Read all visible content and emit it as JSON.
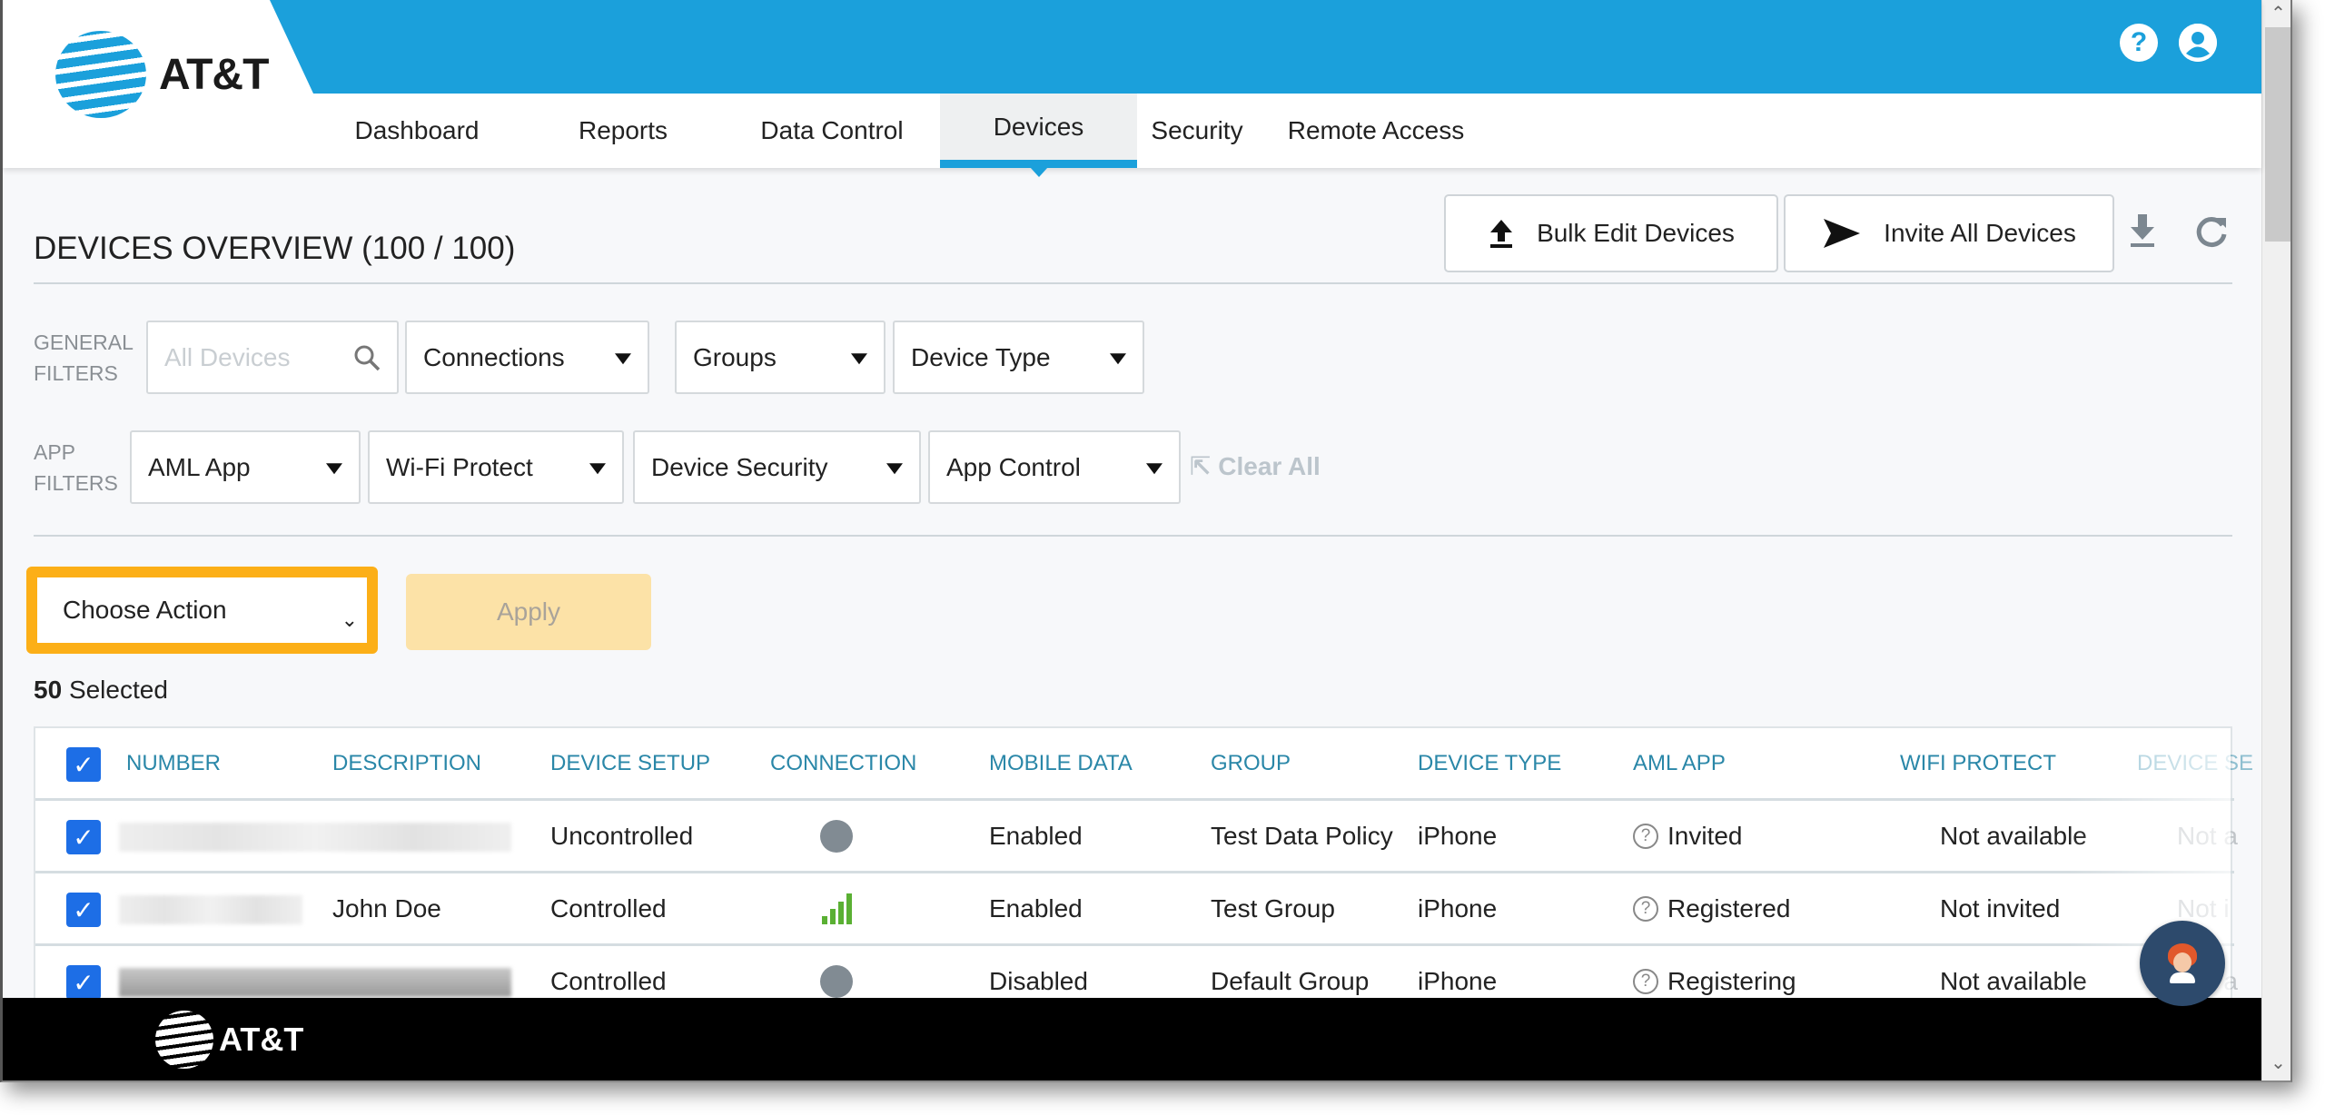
{
  "app": {
    "brand": "AT&T",
    "help_icon": "question-circle-icon",
    "user_icon": "user-circle-icon"
  },
  "nav": {
    "tabs": [
      {
        "label": "Dashboard",
        "active": false
      },
      {
        "label": "Reports",
        "active": false
      },
      {
        "label": "Data Control",
        "active": false
      },
      {
        "label": "Devices",
        "active": true
      },
      {
        "label": "Security",
        "active": false
      },
      {
        "label": "Remote Access",
        "active": false
      }
    ]
  },
  "page": {
    "title": "DEVICES OVERVIEW (100 / 100)",
    "bulk_edit_label": "Bulk Edit Devices",
    "bulk_edit_icon": "upload-icon",
    "invite_all_label": "Invite All Devices",
    "invite_all_icon": "send-icon",
    "download_icon": "download-icon",
    "refresh_icon": "refresh-icon"
  },
  "filters": {
    "general_label_1": "GENERAL",
    "general_label_2": "FILTERS",
    "search_placeholder": "All Devices",
    "connections": "Connections",
    "groups": "Groups",
    "device_type": "Device Type",
    "app_label_1": "APP",
    "app_label_2": "FILTERS",
    "aml_app": "AML App",
    "wifi_protect": "Wi-Fi Protect",
    "device_security": "Device Security",
    "app_control": "App Control",
    "clear_all": "Clear All"
  },
  "actions": {
    "choose_action": "Choose Action",
    "apply": "Apply",
    "selected_count": "50",
    "selected_label": "Selected"
  },
  "table": {
    "columns": [
      "NUMBER",
      "DESCRIPTION",
      "DEVICE SETUP",
      "CONNECTION",
      "MOBILE DATA",
      "GROUP",
      "DEVICE TYPE",
      "AML APP",
      "WIFI PROTECT",
      "DEVICE SE"
    ],
    "rows": [
      {
        "checked": true,
        "description": "",
        "device_setup": "Uncontrolled",
        "connection": "offline",
        "mobile_data": "Enabled",
        "group": "Test Data Policy",
        "device_type": "iPhone",
        "aml_app": "Invited",
        "wifi_protect": "Not available",
        "device_security": "Not a"
      },
      {
        "checked": true,
        "description": "John Doe",
        "device_setup": "Controlled",
        "connection": "signal-full",
        "mobile_data": "Enabled",
        "group": "Test Group",
        "device_type": "iPhone",
        "aml_app": "Registered",
        "wifi_protect": "Not invited",
        "device_security": "Not i"
      },
      {
        "checked": true,
        "description": "",
        "device_setup": "Controlled",
        "connection": "offline",
        "mobile_data": "Disabled",
        "group": "Default Group",
        "device_type": "iPhone",
        "aml_app": "Registering",
        "wifi_protect": "Not available",
        "device_security": "Not a"
      }
    ]
  },
  "footer": {
    "brand": "AT&T"
  },
  "colors": {
    "brand_blue": "#1ba0db",
    "highlight_orange": "#fcaf17",
    "checkbox_blue": "#1d6ee6",
    "header_text_teal": "#2a87a8",
    "signal_green": "#5ab033"
  }
}
